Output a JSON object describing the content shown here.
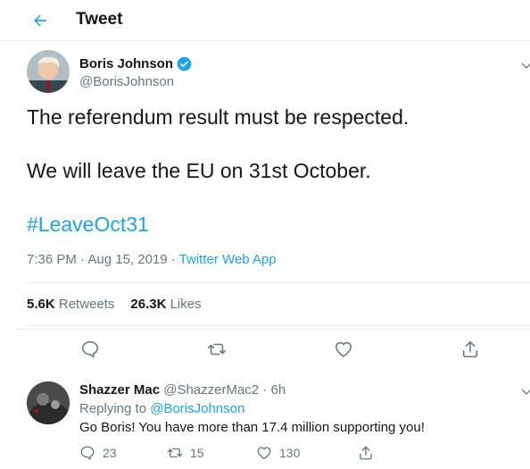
{
  "header": {
    "title": "Tweet",
    "back_icon": "arrow-left-icon"
  },
  "tweet": {
    "author": {
      "name": "Boris Johnson",
      "handle": "@BorisJohnson",
      "verified": true
    },
    "lines": [
      "The referendum result must be respected.",
      "We will leave the EU on 31st October."
    ],
    "hashtag": "#LeaveOct31",
    "time": "7:36 PM · Aug 15, 2019 · ",
    "source": "Twitter Web App",
    "retweets_count": "5.6K",
    "retweets_label": "Retweets",
    "likes_count": "26.3K",
    "likes_label": "Likes"
  },
  "reply": {
    "name": "Shazzer Mac",
    "handle_time": "@ShazzerMac2 · 6h",
    "replying_prefix": "Replying to ",
    "replying_mention": "@BorisJohnson",
    "text": "Go Boris!  You have more than 17.4 million supporting you!",
    "replies": "23",
    "retweets": "15",
    "likes": "130"
  },
  "colors": {
    "accent": "#1da1f2",
    "text": "#14171a",
    "muted": "#657786",
    "border": "#e6ecf0",
    "verified": "#1da1f2"
  }
}
